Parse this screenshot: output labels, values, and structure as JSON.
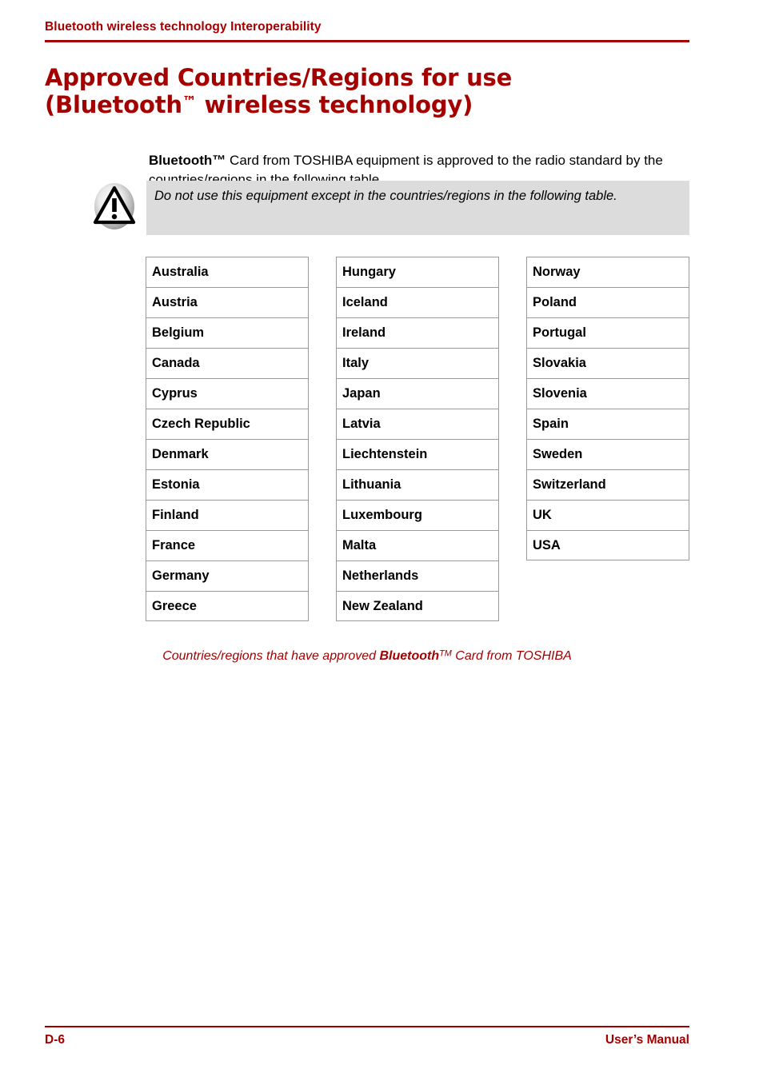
{
  "header": {
    "running_title": "Bluetooth wireless technology Interoperability",
    "rule_color": "#A50000"
  },
  "title": {
    "line1": "Approved Countries/Regions for use",
    "line2_prefix": "(Bluetooth",
    "line2_sup": "™",
    "line2_suffix": " wireless technology)",
    "color": "#A50000"
  },
  "intro": {
    "brand": "Bluetooth",
    "brand_sup": "™",
    "text": " Card from TOSHIBA equipment is approved to the radio standard by the countries/regions in the following table."
  },
  "note": {
    "icon": "warning-triangle-icon",
    "text": "Do not use this equipment except in the countries/regions in the following table.",
    "background": "#dcdcdc"
  },
  "table": {
    "columns": [
      {
        "cells": [
          "Australia",
          "Austria",
          "Belgium",
          "Canada",
          "Cyprus",
          "Czech Republic",
          "Denmark",
          "Estonia",
          "Finland",
          "France",
          "Germany",
          "Greece"
        ]
      },
      {
        "cells": [
          "Hungary",
          "Iceland",
          "Ireland",
          "Italy",
          "Japan",
          "Latvia",
          "Liechtenstein",
          "Lithuania",
          "Luxembourg",
          "Malta",
          "Netherlands",
          "New Zealand"
        ]
      },
      {
        "cells": [
          "Norway",
          "Poland",
          "Portugal",
          "Slovakia",
          "Slovenia",
          "Spain",
          "Sweden",
          "Switzerland",
          "UK",
          "USA"
        ]
      }
    ],
    "border_color": "#9a9a9a"
  },
  "caption": {
    "prefix": "Countries/regions that have approved ",
    "brand": "Bluetooth",
    "brand_sup": "TM",
    "suffix": " Card from TOSHIBA",
    "color": "#A50000"
  },
  "footer": {
    "page_number": "D-6",
    "manual_label": "User’s Manual",
    "color": "#A50000"
  }
}
